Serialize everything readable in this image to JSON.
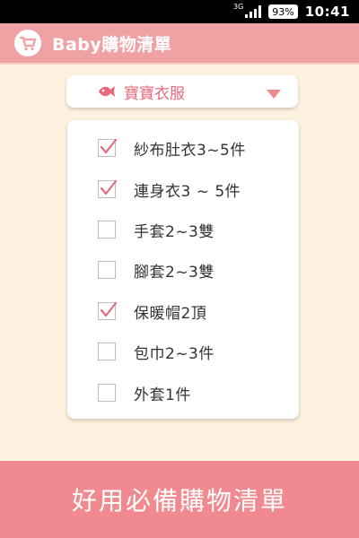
{
  "status_bar": {
    "network": "3G",
    "battery": "93%",
    "time": "10:41"
  },
  "app": {
    "title": "Baby購物清單"
  },
  "category": {
    "label": "寶寶衣服",
    "icon": "fish-icon"
  },
  "checklist": [
    {
      "label": "紗布肚衣3~5件",
      "checked": true
    },
    {
      "label": "連身衣3 ~ 5件",
      "checked": true
    },
    {
      "label": "手套2~3雙",
      "checked": false
    },
    {
      "label": "腳套2~3雙",
      "checked": false
    },
    {
      "label": "保暖帽2頂",
      "checked": true
    },
    {
      "label": "包巾2~3件",
      "checked": false
    },
    {
      "label": "外套1件",
      "checked": false
    }
  ],
  "banner": {
    "text": "好用必備購物清單"
  },
  "colors": {
    "accent": "#f0a1a4",
    "banner": "#f08a90",
    "category_text": "#e86a7b",
    "check": "#e86a7b",
    "background": "#fdf2df"
  }
}
